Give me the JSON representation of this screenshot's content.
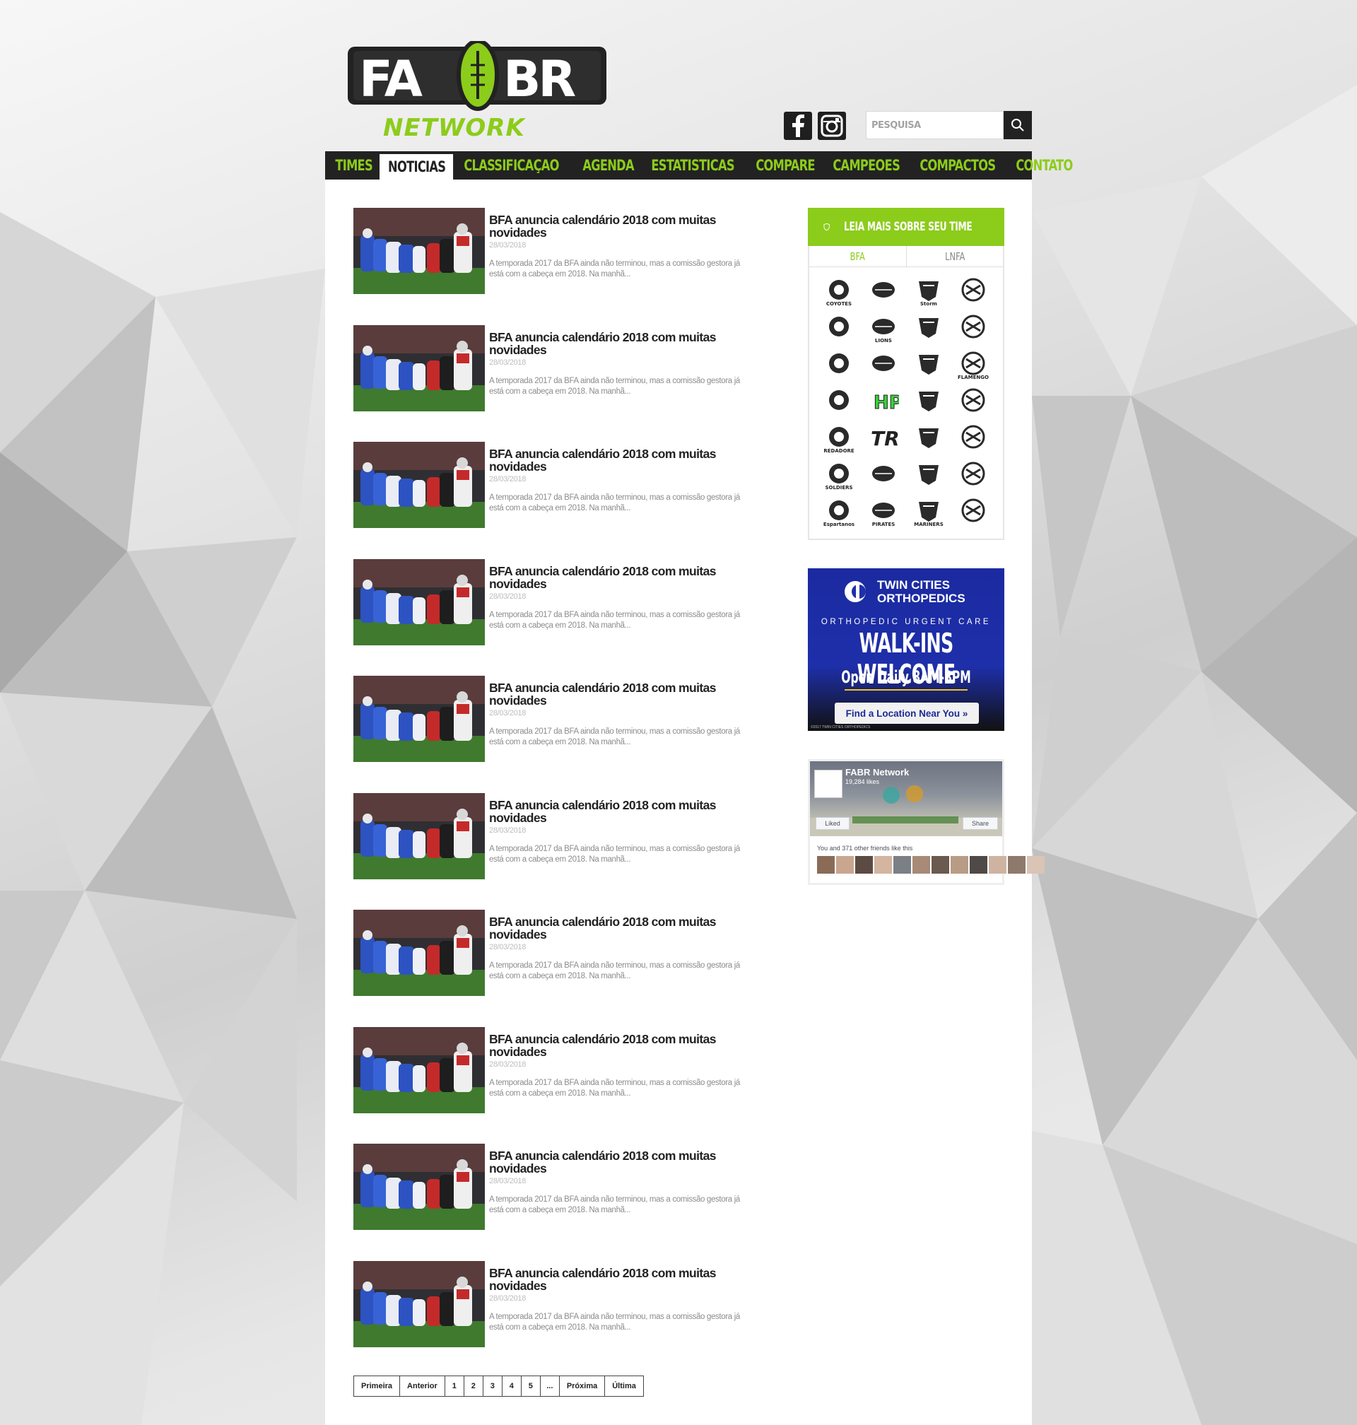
{
  "logo": {
    "top": "FA",
    "top2": "BR",
    "bottom": "NETWORK"
  },
  "search": {
    "placeholder": "PESQUISA"
  },
  "nav": [
    "TIMES",
    "NOTICIAS",
    "CLASSIFICAÇAO",
    "AGENDA",
    "ESTATISTICAS",
    "COMPARE",
    "CAMPEOES",
    "COMPACTOS",
    "CONTATO"
  ],
  "nav_active": "NOTICIAS",
  "news": [
    {
      "title": "BFA anuncia calendário 2018 com muitas novidades",
      "date": "28/03/2018",
      "excerpt": "A temporada 2017 da BFA ainda não terminou, mas a comissão gestora já está com a cabeça em 2018. Na manhã..."
    },
    {
      "title": "BFA anuncia calendário 2018 com muitas novidades",
      "date": "28/03/2018",
      "excerpt": "A temporada 2017 da BFA ainda não terminou, mas a comissão gestora já está com a cabeça em 2018. Na manhã..."
    },
    {
      "title": "BFA anuncia calendário 2018 com muitas novidades",
      "date": "28/03/2018",
      "excerpt": "A temporada 2017 da BFA ainda não terminou, mas a comissão gestora já está com a cabeça em 2018. Na manhã..."
    },
    {
      "title": "BFA anuncia calendário 2018 com muitas novidades",
      "date": "28/03/2018",
      "excerpt": "A temporada 2017 da BFA ainda não terminou, mas a comissão gestora já está com a cabeça em 2018. Na manhã..."
    },
    {
      "title": "BFA anuncia calendário 2018 com muitas novidades",
      "date": "28/03/2018",
      "excerpt": "A temporada 2017 da BFA ainda não terminou, mas a comissão gestora já está com a cabeça em 2018. Na manhã..."
    },
    {
      "title": "BFA anuncia calendário 2018 com muitas novidades",
      "date": "28/03/2018",
      "excerpt": "A temporada 2017 da BFA ainda não terminou, mas a comissão gestora já está com a cabeça em 2018. Na manhã..."
    },
    {
      "title": "BFA anuncia calendário 2018 com muitas novidades",
      "date": "28/03/2018",
      "excerpt": "A temporada 2017 da BFA ainda não terminou, mas a comissão gestora já está com a cabeça em 2018. Na manhã..."
    },
    {
      "title": "BFA anuncia calendário 2018 com muitas novidades",
      "date": "28/03/2018",
      "excerpt": "A temporada 2017 da BFA ainda não terminou, mas a comissão gestora já está com a cabeça em 2018. Na manhã..."
    },
    {
      "title": "BFA anuncia calendário 2018 com muitas novidades",
      "date": "28/03/2018",
      "excerpt": "A temporada 2017 da BFA ainda não terminou, mas a comissão gestora já está com a cabeça em 2018. Na manhã..."
    },
    {
      "title": "BFA anuncia calendário 2018 com muitas novidades",
      "date": "28/03/2018",
      "excerpt": "A temporada 2017 da BFA ainda não terminou, mas a comissão gestora já está com a cabeça em 2018. Na manhã..."
    }
  ],
  "pagination": [
    "Primeira",
    "Anterior",
    "1",
    "2",
    "3",
    "4",
    "5",
    "...",
    "Próxima",
    "Última"
  ],
  "sidebar": {
    "teams_title": "LEIA MAIS SOBRE SEU TIME",
    "tabs": [
      "BFA",
      "LNFA"
    ],
    "active_tab": "BFA",
    "team_logos": [
      "COYOTES",
      "",
      "Storm",
      "",
      "",
      "LIONS",
      "",
      "",
      "",
      "",
      "",
      "FLAMENGO",
      "",
      "HP",
      "",
      "",
      "PREDADORES",
      "TR",
      "",
      "",
      "SOLDIERS",
      "",
      "",
      "",
      "Espartanos",
      "PIRATES",
      "MARINERS",
      ""
    ]
  },
  "ad": {
    "brand_line1": "TWIN CITIES",
    "brand_line2": "ORTHOPEDICS",
    "subtitle": "ORTHOPEDIC URGENT CARE",
    "headline": "WALK-INS WELCOME",
    "hours": "Open Daily 8AM-8PM",
    "button": "Find a Location Near You »",
    "copyright": "©2017 TWIN CITIES ORTHOPEDICS"
  },
  "facebook": {
    "page_name": "FABR Network",
    "likes": "19,284 likes",
    "liked_label": "Liked",
    "share_label": "Share",
    "friends_text": "You and 371 other friends like this"
  },
  "colors": {
    "accent": "#8ccc1b",
    "dark": "#222222"
  }
}
